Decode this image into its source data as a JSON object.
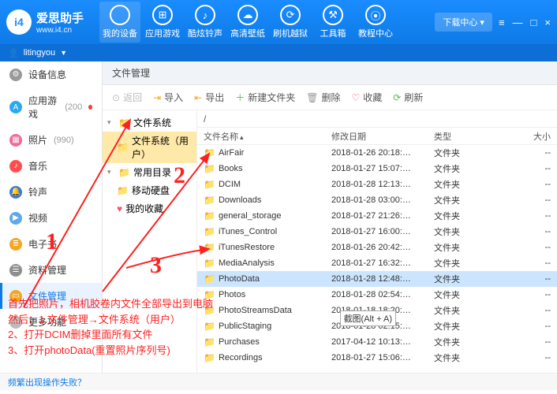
{
  "app": {
    "name": "爱思助手",
    "url": "www.i4.cn"
  },
  "nav": [
    {
      "label": "我的设备",
      "icon": ""
    },
    {
      "label": "应用游戏",
      "icon": "⊞"
    },
    {
      "label": "酷炫铃声",
      "icon": "♪"
    },
    {
      "label": "高清壁纸",
      "icon": "☁"
    },
    {
      "label": "刷机越狱",
      "icon": "⟳"
    },
    {
      "label": "工具箱",
      "icon": "⚒"
    },
    {
      "label": "教程中心",
      "icon": "⦿"
    }
  ],
  "download_btn": "下载中心",
  "user": "litingyou",
  "left": [
    {
      "label": "设备信息",
      "color": "#999",
      "icon": "⚙"
    },
    {
      "label": "应用游戏",
      "count": "(200",
      "color": "#2aa9f3",
      "icon": "A",
      "dot": true
    },
    {
      "label": "照片",
      "count": "(990)",
      "color": "#f06a9b",
      "icon": "▦"
    },
    {
      "label": "音乐",
      "color": "#ff4d4d",
      "icon": "♪"
    },
    {
      "label": "铃声",
      "color": "#3a7bd5",
      "icon": "🔔"
    },
    {
      "label": "视频",
      "color": "#5da9e9",
      "icon": "▶"
    },
    {
      "label": "电子书",
      "color": "#f5a623",
      "icon": "≣"
    },
    {
      "label": "资料管理",
      "color": "#8e8e8e",
      "icon": "☰"
    },
    {
      "label": "文件管理",
      "color": "#f5a623",
      "icon": "▭",
      "active": true
    },
    {
      "label": "更多功能",
      "color": "#bbb",
      "icon": "⋯"
    }
  ],
  "crumb": "文件管理",
  "toolbar": {
    "back": "返回",
    "import": "导入",
    "export": "导出",
    "newfolder": "新建文件夹",
    "delete": "删除",
    "favorite": "收藏",
    "refresh": "刷新"
  },
  "tree": {
    "root": "文件系统",
    "user": "文件系统（用户）",
    "common": "常用目录",
    "mobile": "移动硬盘",
    "fav": "我的收藏"
  },
  "path": "/",
  "columns": {
    "name": "文件名称",
    "mod": "修改日期",
    "type": "类型",
    "size": "大小"
  },
  "rows": [
    {
      "n": "AirFair",
      "m": "2018-01-26 20:18:…",
      "t": "文件夹",
      "s": "--"
    },
    {
      "n": "Books",
      "m": "2018-01-27 15:07:…",
      "t": "文件夹",
      "s": "--"
    },
    {
      "n": "DCIM",
      "m": "2018-01-28 12:13:…",
      "t": "文件夹",
      "s": "--"
    },
    {
      "n": "Downloads",
      "m": "2018-01-28 03:00:…",
      "t": "文件夹",
      "s": "--"
    },
    {
      "n": "general_storage",
      "m": "2018-01-27 21:26:…",
      "t": "文件夹",
      "s": "--"
    },
    {
      "n": "iTunes_Control",
      "m": "2018-01-27 16:00:…",
      "t": "文件夹",
      "s": "--"
    },
    {
      "n": "iTunesRestore",
      "m": "2018-01-26 20:42:…",
      "t": "文件夹",
      "s": "--"
    },
    {
      "n": "MediaAnalysis",
      "m": "2018-01-27 16:32:…",
      "t": "文件夹",
      "s": "--"
    },
    {
      "n": "PhotoData",
      "m": "2018-01-28 12:48:…",
      "t": "文件夹",
      "s": "--",
      "sel": true
    },
    {
      "n": "Photos",
      "m": "2018-01-28 02:54:…",
      "t": "文件夹",
      "s": "--"
    },
    {
      "n": "PhotoStreamsData",
      "m": "2018-01-18 18:20:…",
      "t": "文件夹",
      "s": "--"
    },
    {
      "n": "PublicStaging",
      "m": "2018-01-28 02:15:…",
      "t": "文件夹",
      "s": "--"
    },
    {
      "n": "Purchases",
      "m": "2017-04-12 10:13:…",
      "t": "文件夹",
      "s": "--"
    },
    {
      "n": "Recordings",
      "m": "2018-01-27 15:06:…",
      "t": "文件夹",
      "s": "--"
    }
  ],
  "tooltip": "截图(Alt + A)",
  "annotations": {
    "l1": "首先把照片，相机胶卷内文件全部导出到电脑",
    "l2": "然后：1.文件管理→文件系统（用户）",
    "l3": "2、打开DCIM删掉里面所有文件",
    "l4": "3、打开photoData(重置照片序列号)"
  },
  "footer": "频繁出现操作失败？"
}
